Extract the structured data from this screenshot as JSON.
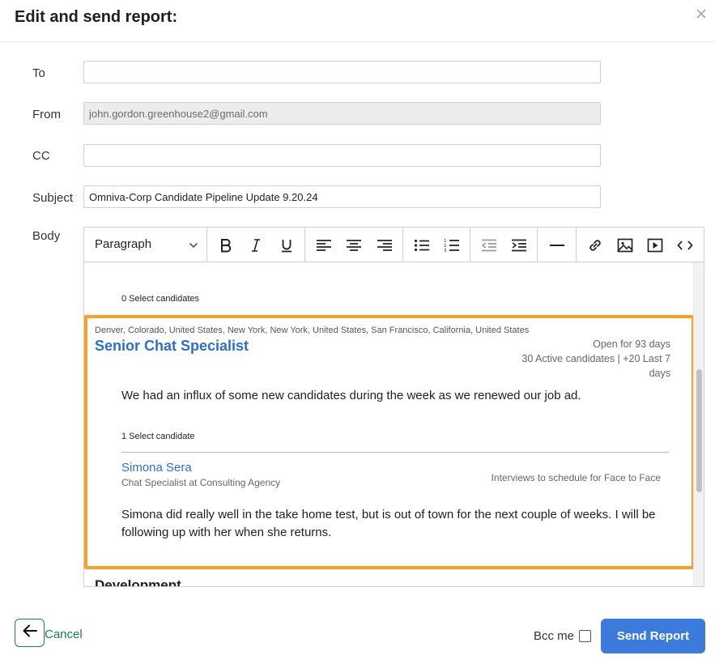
{
  "dialog": {
    "title": "Edit and send report:",
    "close_icon": "close-icon"
  },
  "fields": {
    "to": {
      "label": "To",
      "value": "",
      "placeholder": ""
    },
    "from": {
      "label": "From",
      "value": "john.gordon.greenhouse2@gmail.com"
    },
    "cc": {
      "label": "CC",
      "value": "",
      "placeholder": ""
    },
    "subject": {
      "label": "Subject",
      "value": "Omniva-Corp Candidate Pipeline Update 9.20.24"
    },
    "body": {
      "label": "Body"
    }
  },
  "toolbar": {
    "paragraph_select": "Paragraph",
    "icons": [
      "bold-icon",
      "italic-icon",
      "underline-icon",
      "align-left-icon",
      "align-center-icon",
      "align-right-icon",
      "bulleted-list-icon",
      "numbered-list-icon",
      "outdent-icon",
      "indent-icon",
      "horizontal-rule-icon",
      "link-icon",
      "image-icon",
      "video-icon",
      "code-icon"
    ]
  },
  "body_content": {
    "top_select_candidates": "0 Select candidates",
    "job": {
      "locations": "Denver, Colorado, United States, New York, New York, United States, San Francisco, California, United States",
      "title": "Senior Chat Specialist",
      "open_for": "Open for 93 days",
      "active_candidates": "30 Active candidates | +20 Last 7 days",
      "note": "We had an influx of some new candidates during the week as we renewed our job ad.",
      "select_candidate": "1 Select candidate",
      "candidate": {
        "name": "Simona Sera",
        "role": "Chat Specialist at Consulting Agency",
        "status": "Interviews to schedule for Face to Face",
        "note": "Simona did really well in the take home test, but is out of town for the next couple of weeks. I will be following up with her when she returns."
      }
    },
    "next_section_heading": "Development",
    "highlight_color": "#f5a12a"
  },
  "footer": {
    "back_icon": "arrow-left-icon",
    "cancel_label": "Cancel",
    "bcc_label": "Bcc me",
    "bcc_checked": false,
    "send_label": "Send Report"
  },
  "colors": {
    "link_blue": "#2d6fc9",
    "primary_button": "#3c7bdb",
    "cancel_green": "#1d7a56"
  }
}
